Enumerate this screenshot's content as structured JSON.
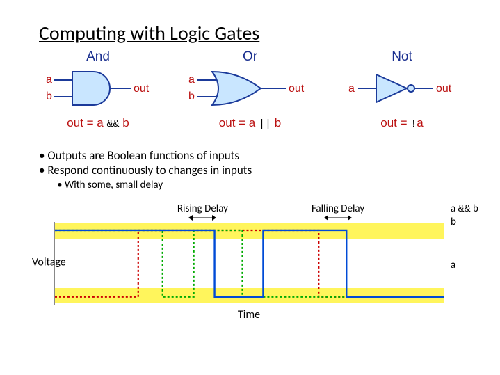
{
  "title": "Computing with Logic Gates",
  "gates": {
    "and": {
      "name": "And",
      "in1": "a",
      "in2": "b",
      "out": "out",
      "eq_pre": "out = a ",
      "op": "&&",
      "eq_post": " b"
    },
    "or": {
      "name": "Or",
      "in1": "a",
      "in2": "b",
      "out": "out",
      "eq_pre": "out = a ",
      "op": "||",
      "eq_post": " b"
    },
    "not": {
      "name": "Not",
      "in1": "a",
      "out": "out",
      "eq_pre": "out = ",
      "op": " !",
      "eq_post": "a"
    }
  },
  "bullets": {
    "b1": "Outputs are Boolean functions of inputs",
    "b2": "Respond continuously to changes in inputs",
    "b3": "With some, small delay"
  },
  "timing": {
    "rising": "Rising Delay",
    "falling": "Falling Delay",
    "ylabel": "Voltage",
    "xlabel": "Time",
    "sig_out": "a && b",
    "sig_b": "b",
    "sig_a": "a"
  },
  "chart_data": {
    "type": "line",
    "title": "Gate delay timing diagram",
    "xlabel": "Time",
    "ylabel": "Voltage",
    "ylim": [
      0,
      1
    ],
    "annotations": [
      "Rising Delay",
      "Falling Delay"
    ],
    "series": [
      {
        "name": "a",
        "color": "#c00",
        "style": "dotted",
        "points": [
          [
            0,
            0
          ],
          [
            120,
            0
          ],
          [
            120,
            1
          ],
          [
            380,
            1
          ],
          [
            380,
            0
          ],
          [
            560,
            0
          ]
        ]
      },
      {
        "name": "b",
        "color": "#0a0",
        "style": "dotted",
        "points": [
          [
            0,
            1
          ],
          [
            155,
            1
          ],
          [
            155,
            0
          ],
          [
            200,
            0
          ],
          [
            200,
            1
          ],
          [
            270,
            1
          ],
          [
            270,
            0
          ],
          [
            560,
            0
          ]
        ]
      },
      {
        "name": "a && b",
        "color": "#004bd6",
        "style": "solid",
        "points": [
          [
            0,
            1
          ],
          [
            230,
            1
          ],
          [
            230,
            0
          ],
          [
            300,
            0
          ],
          [
            300,
            1
          ],
          [
            420,
            1
          ],
          [
            420,
            0
          ],
          [
            560,
            0
          ]
        ]
      }
    ]
  }
}
